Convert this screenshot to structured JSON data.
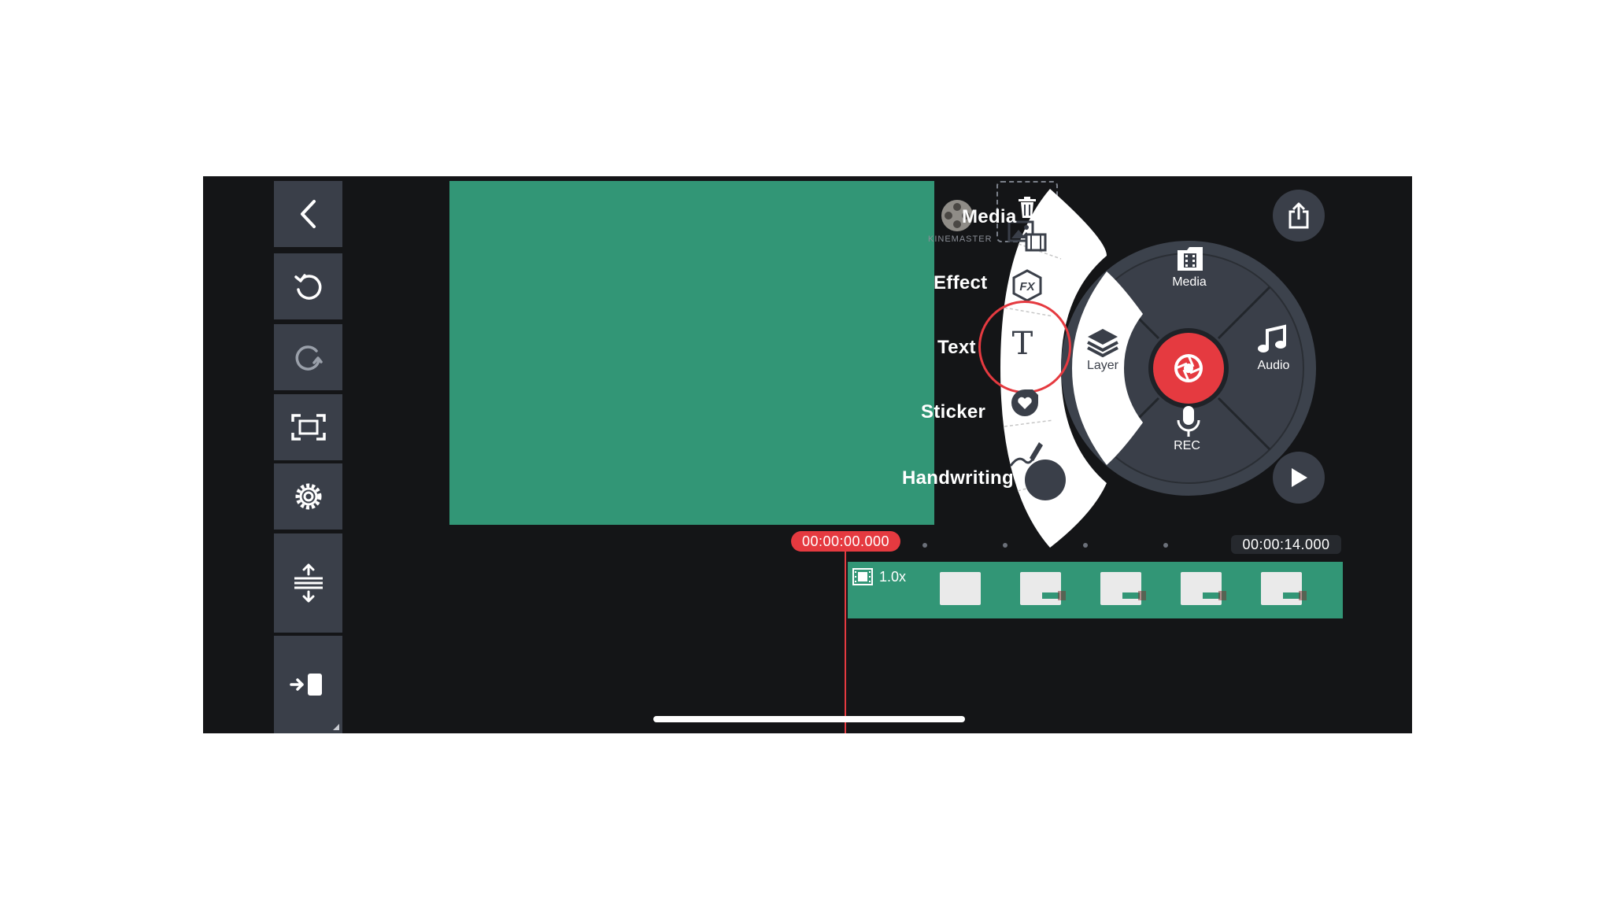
{
  "app": {
    "name": "KineMaster",
    "watermark_text": "KINEMASTER"
  },
  "colors": {
    "background": "#141517",
    "panel": "#3a3f49",
    "accent_red": "#e53a40",
    "clip_green": "#329676",
    "preview_green": "#329676",
    "wheel_dark": "#3c424c"
  },
  "toolbar": {
    "items": [
      {
        "name": "back",
        "icon": "chevron-left-icon"
      },
      {
        "name": "undo",
        "icon": "undo-icon"
      },
      {
        "name": "redo",
        "icon": "redo-icon"
      },
      {
        "name": "fullscreen",
        "icon": "frame-icon"
      },
      {
        "name": "settings",
        "icon": "gear-icon"
      },
      {
        "name": "expand-timeline",
        "icon": "expand-vertical-icon"
      },
      {
        "name": "jump-to-start",
        "icon": "jump-start-icon"
      }
    ]
  },
  "layer_menu": {
    "items": [
      {
        "label": "Media",
        "icon": "image-film-icon"
      },
      {
        "label": "Effect",
        "icon": "fx-icon"
      },
      {
        "label": "Text",
        "icon": "text-t-icon"
      },
      {
        "label": "Sticker",
        "icon": "sticker-heart-icon"
      },
      {
        "label": "Handwriting",
        "icon": "pen-icon"
      }
    ]
  },
  "wheel": {
    "media": "Media",
    "audio": "Audio",
    "rec": "REC",
    "layer": "Layer",
    "center_icon": "camera-shutter-icon"
  },
  "timeline": {
    "current_time": "00:00:00.000",
    "total_time": "00:00:14.000",
    "clip_speed": "1.0x",
    "thumbnail_count": 5
  }
}
